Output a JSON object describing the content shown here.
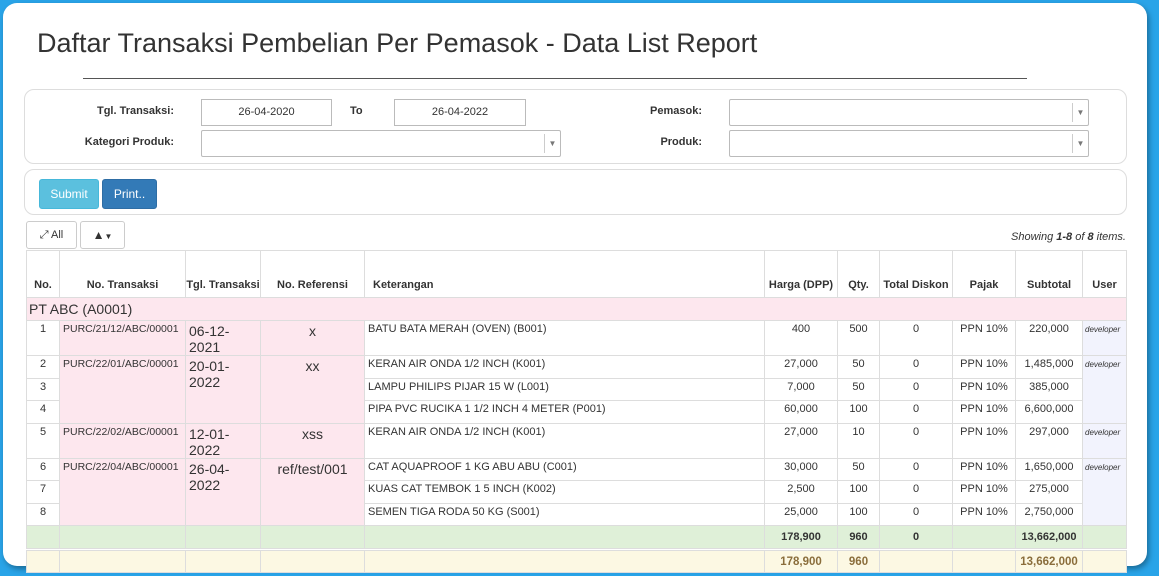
{
  "page": {
    "title": "Daftar Transaksi Pembelian Per Pemasok - Data List Report"
  },
  "filters": {
    "tgl_label": "Tgl. Transaksi:",
    "date_from": "26-04-2020",
    "to_label": "To",
    "date_to": "26-04-2022",
    "pemasok_label": "Pemasok:",
    "pemasok_value": "",
    "kategori_label": "Kategori Produk:",
    "kategori_value": "",
    "produk_label": "Produk:",
    "produk_value": ""
  },
  "actions": {
    "submit": "Submit",
    "print": "Print..",
    "all": "All"
  },
  "summary": {
    "prefix": "Showing ",
    "range": "1-8",
    "of": " of ",
    "total": "8",
    "suffix": " items."
  },
  "table": {
    "headers": {
      "no": "No.",
      "no_transaksi": "No. Transaksi",
      "tgl_transaksi": "Tgl. Transaksi",
      "no_referensi": "No. Referensi",
      "keterangan": "Keterangan",
      "harga": "Harga (DPP)",
      "qty": "Qty.",
      "total_diskon": "Total Diskon",
      "pajak": "Pajak",
      "subtotal": "Subtotal",
      "user": "User"
    },
    "group": "PT ABC (A0001)",
    "transactions": [
      {
        "no_transaksi": "PURC/21/12/ABC/00001",
        "tgl": "06-12-2021",
        "ref": "x",
        "user": "developer"
      },
      {
        "no_transaksi": "PURC/22/01/ABC/00001",
        "tgl": "20-01-2022",
        "ref": "xx",
        "user": "developer"
      },
      {
        "no_transaksi": "PURC/22/02/ABC/00001",
        "tgl": "12-01-2022",
        "ref": "xss",
        "user": "developer"
      },
      {
        "no_transaksi": "PURC/22/04/ABC/00001",
        "tgl": "26-04-2022",
        "ref": "ref/test/001",
        "user": "developer"
      }
    ],
    "rows": [
      {
        "no": "1",
        "keterangan": "BATU BATA MERAH (OVEN) (B001)",
        "harga": "400",
        "qty": "500",
        "diskon": "0",
        "pajak": "PPN 10%",
        "subtotal": "220,000"
      },
      {
        "no": "2",
        "keterangan": "KERAN AIR ONDA 1/2 INCH (K001)",
        "harga": "27,000",
        "qty": "50",
        "diskon": "0",
        "pajak": "PPN 10%",
        "subtotal": "1,485,000"
      },
      {
        "no": "3",
        "keterangan": "LAMPU PHILIPS PIJAR 15 W (L001)",
        "harga": "7,000",
        "qty": "50",
        "diskon": "0",
        "pajak": "PPN 10%",
        "subtotal": "385,000"
      },
      {
        "no": "4",
        "keterangan": "PIPA PVC RUCIKA 1 1/2 INCH 4 METER (P001)",
        "harga": "60,000",
        "qty": "100",
        "diskon": "0",
        "pajak": "PPN 10%",
        "subtotal": "6,600,000"
      },
      {
        "no": "5",
        "keterangan": "KERAN AIR ONDA 1/2 INCH (K001)",
        "harga": "27,000",
        "qty": "10",
        "diskon": "0",
        "pajak": "PPN 10%",
        "subtotal": "297,000"
      },
      {
        "no": "6",
        "keterangan": "CAT AQUAPROOF 1 KG ABU ABU (C001)",
        "harga": "30,000",
        "qty": "50",
        "diskon": "0",
        "pajak": "PPN 10%",
        "subtotal": "1,650,000"
      },
      {
        "no": "7",
        "keterangan": "KUAS CAT TEMBOK 1 5 INCH (K002)",
        "harga": "2,500",
        "qty": "100",
        "diskon": "0",
        "pajak": "PPN 10%",
        "subtotal": "275,000"
      },
      {
        "no": "8",
        "keterangan": "SEMEN TIGA RODA 50 KG (S001)",
        "harga": "25,000",
        "qty": "100",
        "diskon": "0",
        "pajak": "PPN 10%",
        "subtotal": "2,750,000"
      }
    ],
    "group_total": {
      "harga": "178,900",
      "qty": "960",
      "diskon": "0",
      "subtotal": "13,662,000"
    },
    "grand_total": {
      "harga": "178,900",
      "qty": "960",
      "subtotal": "13,662,000"
    }
  },
  "colors": {
    "background": "#29a4e8",
    "group_row": "#fde7ee",
    "group_total_row": "#dff0d8",
    "grand_total_row": "#fcf8e3",
    "submit_button": "#5bc0de",
    "print_button": "#337ab7"
  }
}
